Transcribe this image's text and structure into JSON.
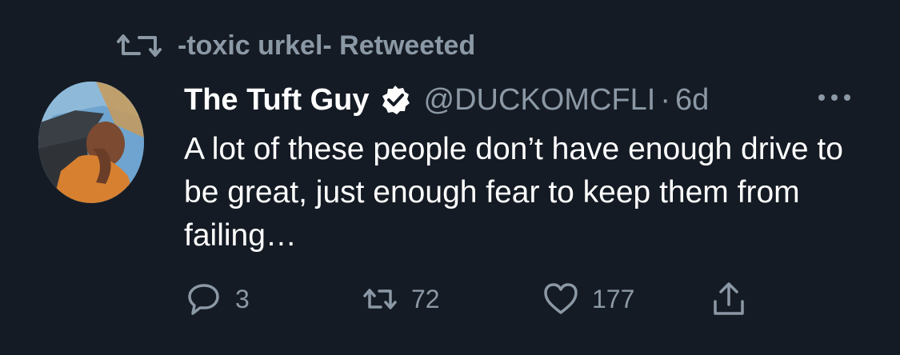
{
  "retweet_context": {
    "text": "-toxic urkel- Retweeted"
  },
  "tweet": {
    "author_name": "The Tuft Guy",
    "handle": "@DUCKOMCFLI",
    "separator": "·",
    "time": "6d",
    "text": "A lot of these people don’t have enough drive to be great, just enough fear to keep them from failing…"
  },
  "actions": {
    "reply_count": "3",
    "retweet_count": "72",
    "like_count": "177"
  },
  "icons": [
    "retweet-icon",
    "verified-badge-icon",
    "more-options-icon",
    "reply-icon",
    "retweet-icon",
    "like-icon",
    "share-icon"
  ],
  "colors": {
    "background": "#151b24",
    "text_primary": "#ffffff",
    "text_secondary": "#8b98a5"
  }
}
